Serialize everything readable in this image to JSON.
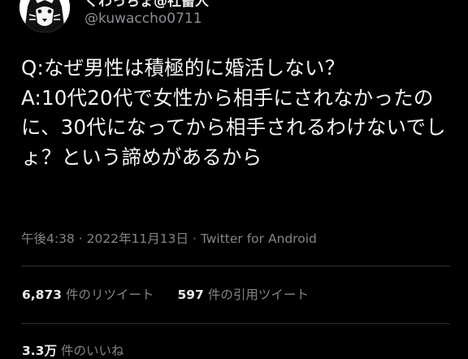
{
  "author": {
    "display_name": "くわっちょ@社畜人",
    "handle": "@kuwaccho0711"
  },
  "tweet": {
    "text": "Q:なぜ男性は積極的に婚活しない？\nA:10代20代で女性から相手にされなかったのに、30代になってから相手されるわけないでしょ？という諦めがあるから"
  },
  "meta": {
    "time": "午後4:38",
    "separator": "·",
    "date": "2022年11月13日",
    "source": "Twitter for Android"
  },
  "stats": {
    "retweets_count": "6,873",
    "retweets_label": "件のリツイート",
    "quotes_count": "597",
    "quotes_label": "件の引用ツイート",
    "likes_count": "3.3万",
    "likes_label": "件のいいね"
  },
  "colors": {
    "background": "#000000",
    "text": "#e7e9ea",
    "secondary": "#808589",
    "divider": "#2c2f33"
  },
  "icons": {
    "avatar": "husky-avatar-icon"
  }
}
